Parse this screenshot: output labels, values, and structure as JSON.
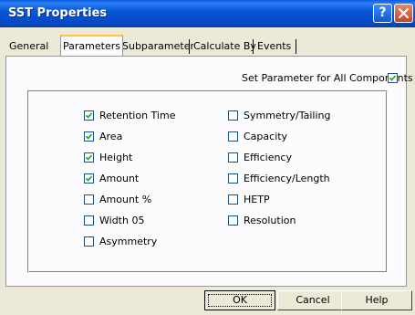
{
  "window": {
    "title": "SST Properties",
    "help_glyph": "?",
    "close_icon": "close-icon"
  },
  "tabs": [
    {
      "label": "General",
      "active": false
    },
    {
      "label": "Parameters",
      "active": true
    },
    {
      "label": "Subparameters",
      "active": false
    },
    {
      "label": "Calculate By",
      "active": false
    },
    {
      "label": "Events",
      "active": false
    }
  ],
  "set_all": {
    "label": "Set Parameter for All Components",
    "checked": true
  },
  "parameters_left": [
    {
      "label": "Retention Time",
      "checked": true
    },
    {
      "label": "Area",
      "checked": true
    },
    {
      "label": "Height",
      "checked": true
    },
    {
      "label": "Amount",
      "checked": true
    },
    {
      "label": "Amount %",
      "checked": false
    },
    {
      "label": "Width 05",
      "checked": false
    },
    {
      "label": "Asymmetry",
      "checked": false
    }
  ],
  "parameters_right": [
    {
      "label": "Symmetry/Tailing",
      "checked": false
    },
    {
      "label": "Capacity",
      "checked": false
    },
    {
      "label": "Efficiency",
      "checked": false
    },
    {
      "label": "Efficiency/Length",
      "checked": false
    },
    {
      "label": "HETP",
      "checked": false
    },
    {
      "label": "Resolution",
      "checked": false
    }
  ],
  "buttons": {
    "ok": "OK",
    "cancel": "Cancel",
    "help": "Help"
  }
}
